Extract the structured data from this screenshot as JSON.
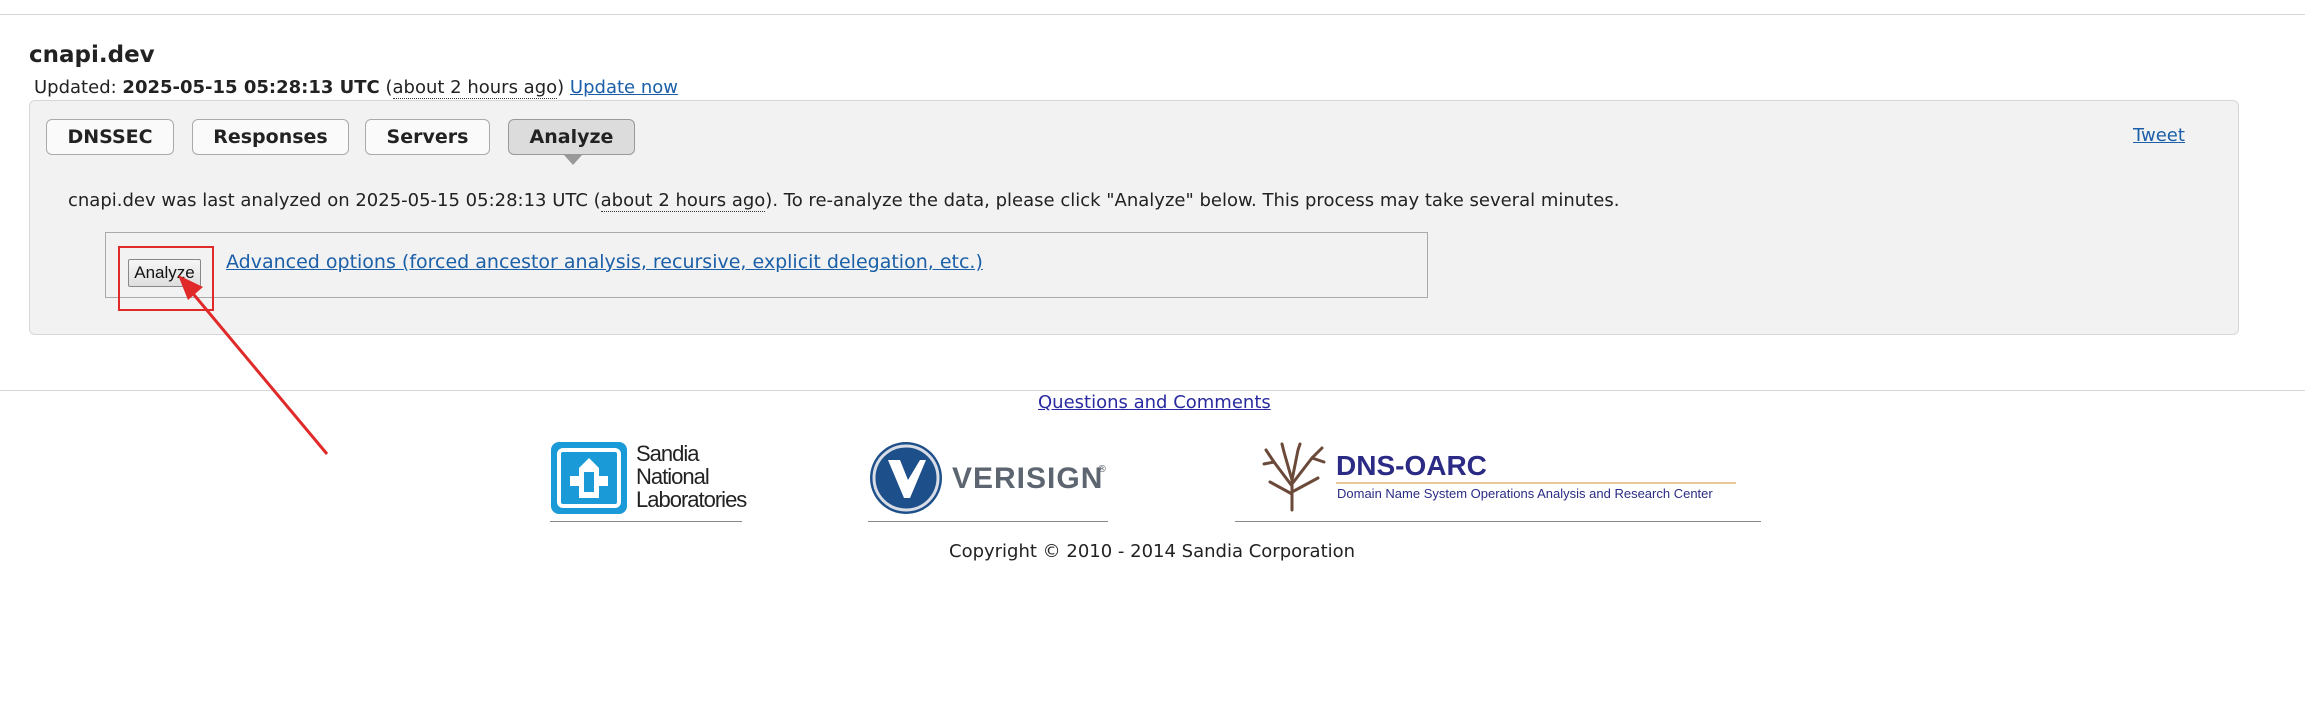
{
  "header": {
    "domain": "cnapi.dev",
    "updated_prefix": "Updated:",
    "updated_timestamp": "2025-05-15 05:28:13 UTC",
    "paren_open": "(",
    "relative_time": "about 2 hours ago",
    "paren_close": ")",
    "update_now": "Update now"
  },
  "tabs": [
    {
      "label": "DNSSEC",
      "active": false
    },
    {
      "label": "Responses",
      "active": false
    },
    {
      "label": "Servers",
      "active": false
    },
    {
      "label": "Analyze",
      "active": true
    }
  ],
  "tweet_label": "Tweet",
  "analyze": {
    "msg_prefix": "cnapi.dev was last analyzed on 2025-05-15 05:28:13 UTC (",
    "msg_relative": "about 2 hours ago",
    "msg_suffix": "). To re-analyze the data, please click \"Analyze\" below. This process may take several minutes.",
    "button_label": "Analyze",
    "advanced_options": "Advanced options (forced ancestor analysis, recursive, explicit delegation, etc.)"
  },
  "footer": {
    "questions": "Questions and Comments",
    "logos": {
      "sandia": [
        "Sandia",
        "National",
        "Laboratories"
      ],
      "verisign": "VERISIGN",
      "verisign_mark": "®",
      "dnsoarc_title": "DNS-OARC",
      "dnsoarc_subtitle": "Domain Name System Operations Analysis and Research Center"
    },
    "copyright": "Copyright © 2010 - 2014 Sandia Corporation"
  },
  "colors": {
    "link": "#1a5fa8",
    "annotation_red": "#e02a2a",
    "panel_bg": "#f2f2f2",
    "sandia_blue": "#1a9ad6",
    "verisign_blue": "#1d4f8a",
    "oarc_navy": "#2b2b86"
  }
}
